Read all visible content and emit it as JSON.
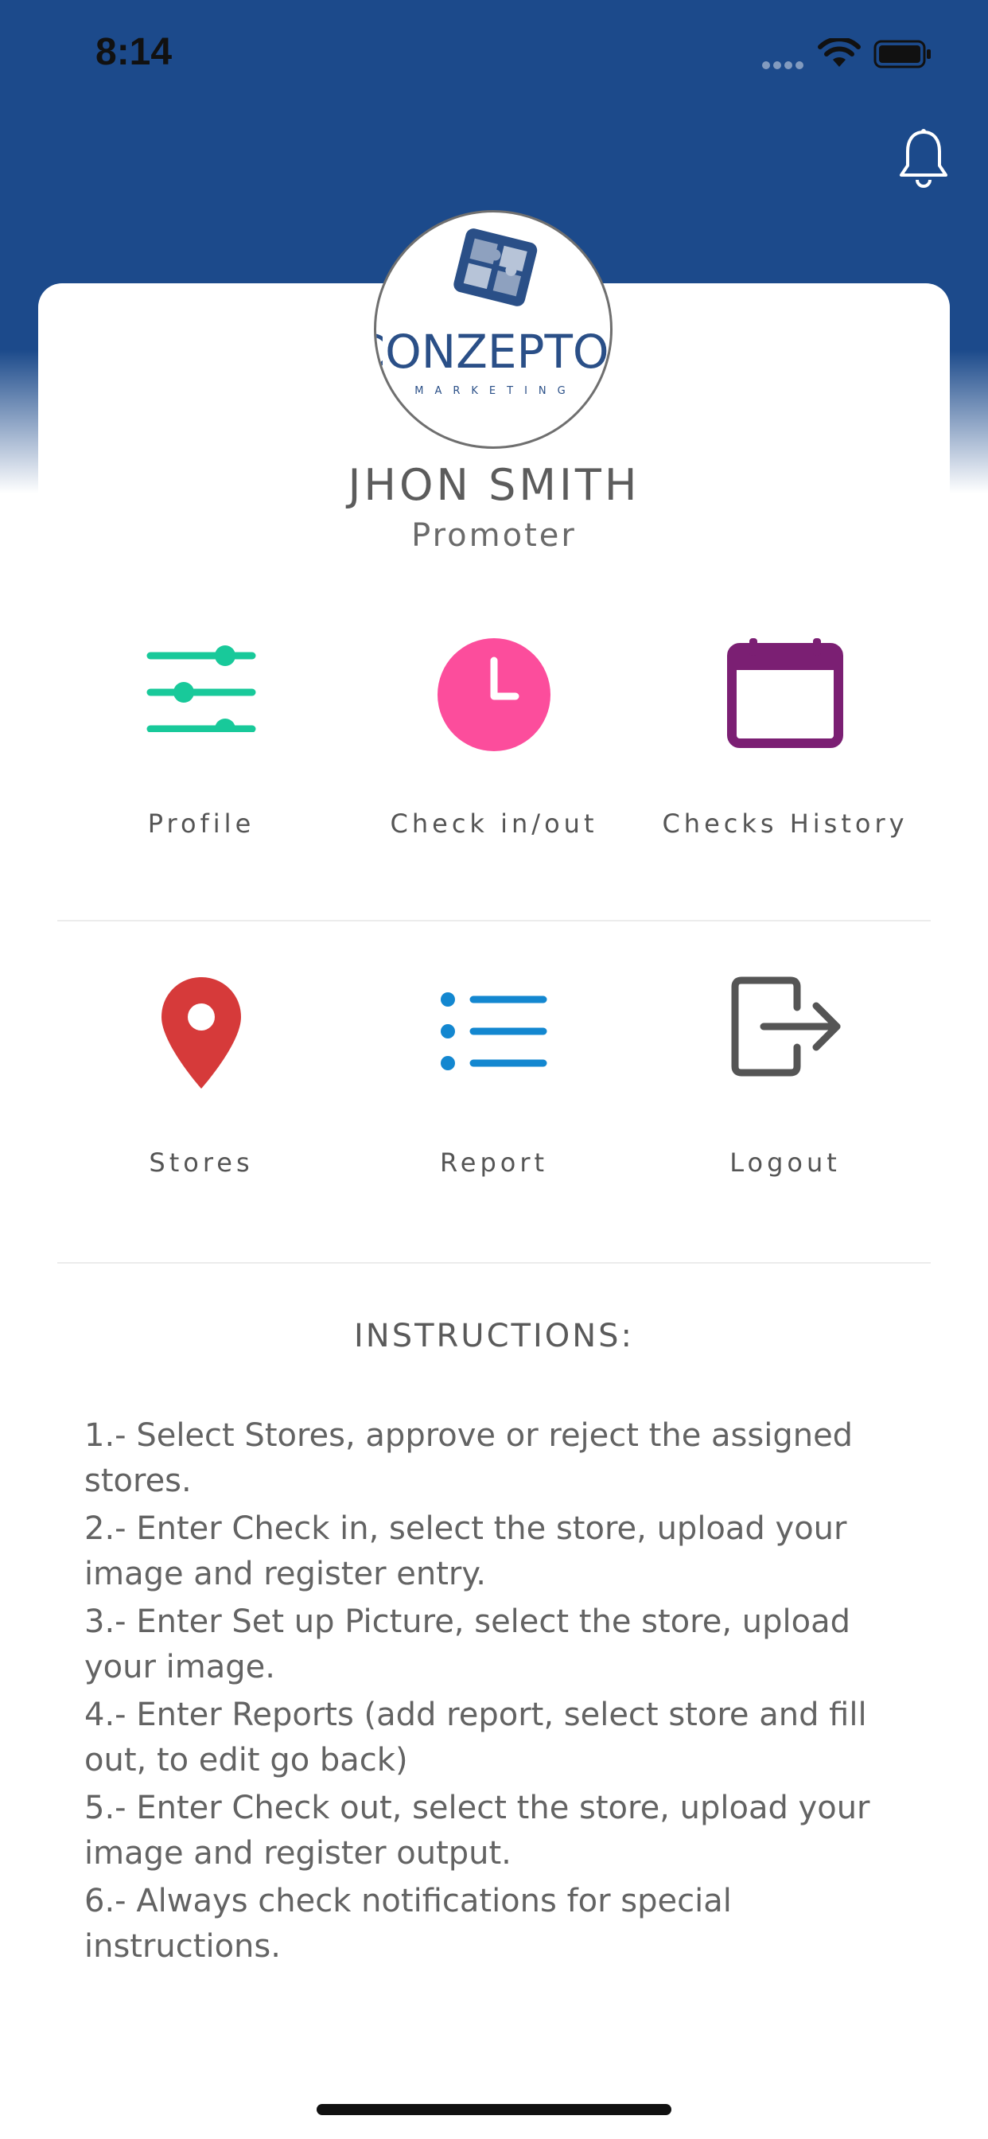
{
  "status_bar": {
    "time": "8:14"
  },
  "profile": {
    "logo_text": "CONZEPTOS",
    "logo_subtext": "MARKETING",
    "name": "JHON SMITH",
    "role": "Promoter"
  },
  "menu": [
    {
      "label": "Profile",
      "icon": "sliders-icon",
      "color": "#18c99a"
    },
    {
      "label": "Check in/out",
      "icon": "clock-icon",
      "color": "#fc4d9c"
    },
    {
      "label": "Checks History",
      "icon": "calendar-icon",
      "color": "#7b1f73"
    },
    {
      "label": "Stores",
      "icon": "location-pin-icon",
      "color": "#d63a3a"
    },
    {
      "label": "Report",
      "icon": "list-icon",
      "color": "#1387d0"
    },
    {
      "label": "Logout",
      "icon": "logout-icon",
      "color": "#555555"
    }
  ],
  "instructions": {
    "title": "INSTRUCTIONS:",
    "items": [
      "1.- Select Stores, approve or reject the assigned stores.",
      "2.- Enter Check in, select the store, upload your image and register entry.",
      "3.- Enter Set up Picture, select the store, upload your image.",
      "4.- Enter Reports (add report, select store and fill out, to edit go back)",
      "5.- Enter Check out, select the store, upload your image and register output.",
      "6.- Always check notifications for special instructions."
    ]
  },
  "colors": {
    "header": "#1c4a8b",
    "background": "#ffffff"
  }
}
